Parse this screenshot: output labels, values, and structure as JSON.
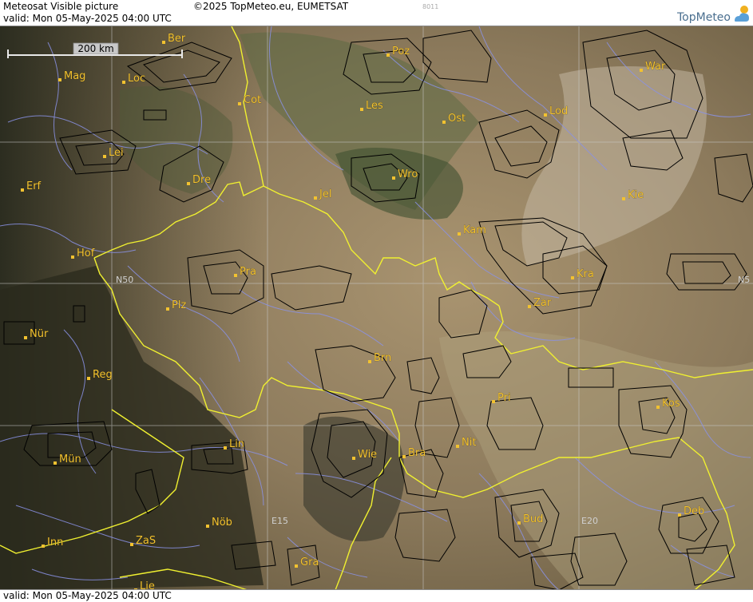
{
  "header": {
    "title": "Meteosat Visible picture",
    "valid_line": "valid:  Mon  05-May-2025  04:00 UTC",
    "copyright": "©2025 TopMeteo.eu, EUMETSAT",
    "code": "8011",
    "brand": "TopMeteo"
  },
  "footer": {
    "valid_line": "valid:  Mon  05-May-2025  04:00 UTC"
  },
  "map": {
    "scale_label": "200 km",
    "grid_labels": {
      "n50_left": "N50",
      "n50_right": "N5",
      "e15": "E15",
      "e20": "E20"
    },
    "cities": [
      {
        "id": "ber",
        "label": "Ber"
      },
      {
        "id": "mag",
        "label": "Mag"
      },
      {
        "id": "loc",
        "label": "Loc"
      },
      {
        "id": "cot",
        "label": "Cot"
      },
      {
        "id": "poz",
        "label": "Poz"
      },
      {
        "id": "war",
        "label": "War"
      },
      {
        "id": "les",
        "label": "Les"
      },
      {
        "id": "ost",
        "label": "Ost"
      },
      {
        "id": "lod",
        "label": "Lod"
      },
      {
        "id": "lei",
        "label": "Lei"
      },
      {
        "id": "dre",
        "label": "Dre"
      },
      {
        "id": "wro",
        "label": "Wro"
      },
      {
        "id": "erf",
        "label": "Erf"
      },
      {
        "id": "jel",
        "label": "Jel"
      },
      {
        "id": "kie",
        "label": "Kie"
      },
      {
        "id": "kam",
        "label": "Kam"
      },
      {
        "id": "hof",
        "label": "Hof"
      },
      {
        "id": "pra",
        "label": "Pra"
      },
      {
        "id": "kra",
        "label": "Kra"
      },
      {
        "id": "plz",
        "label": "Plz"
      },
      {
        "id": "zar",
        "label": "Zar"
      },
      {
        "id": "nur",
        "label": "Nür"
      },
      {
        "id": "brn",
        "label": "Brn"
      },
      {
        "id": "reg",
        "label": "Reg"
      },
      {
        "id": "pri",
        "label": "Pri"
      },
      {
        "id": "kos",
        "label": "Kos"
      },
      {
        "id": "lin",
        "label": "Lin"
      },
      {
        "id": "nit",
        "label": "Nit"
      },
      {
        "id": "mun",
        "label": "Mün"
      },
      {
        "id": "wie",
        "label": "Wie"
      },
      {
        "id": "bra",
        "label": "Bra"
      },
      {
        "id": "nob",
        "label": "Nöb"
      },
      {
        "id": "bud",
        "label": "Bud"
      },
      {
        "id": "deb",
        "label": "Deb"
      },
      {
        "id": "inn",
        "label": "Inn"
      },
      {
        "id": "zas",
        "label": "ZaS"
      },
      {
        "id": "gra",
        "label": "Gra"
      },
      {
        "id": "lie",
        "label": "Lie"
      }
    ]
  },
  "colors": {
    "border": "#f0f030",
    "river": "#8a92e6",
    "grid": "#c8c8c8",
    "city": "#f2c230",
    "contour": "#000000"
  }
}
